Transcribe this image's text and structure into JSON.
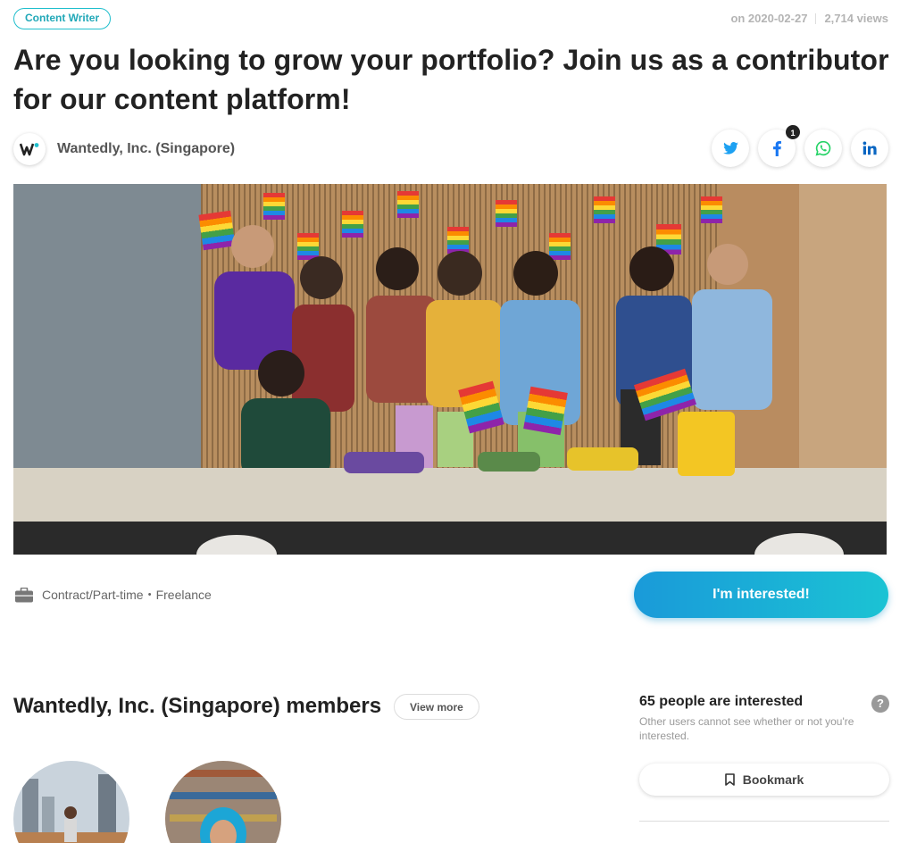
{
  "header": {
    "role_badge": "Content Writer",
    "posted_date": "on 2020-02-27",
    "views": "2,714 views",
    "title": "Are you looking to grow your portfolio? Join us as a contributor for our content platform!"
  },
  "company": {
    "name": "Wantedly, Inc. (Singapore)",
    "logo_icon": "wantedly-logo"
  },
  "share": {
    "buttons": [
      "twitter-icon",
      "facebook-icon",
      "whatsapp-icon",
      "linkedin-icon"
    ],
    "facebook_count": "1"
  },
  "job": {
    "employment_type": "Contract/Part-time・Freelance",
    "cta_label": "I'm interested!"
  },
  "members": {
    "title": "Wantedly, Inc. (Singapore) members",
    "view_more_label": "View more"
  },
  "interest": {
    "count_text": "65 people are interested",
    "note": "Other users cannot see whether or not you're interested.",
    "help_label": "?",
    "bookmark_label": "Bookmark"
  },
  "colors": {
    "accent": "#21bfcd",
    "cta_gradient_start": "#1a9ad9",
    "cta_gradient_end": "#1bc3d4",
    "twitter": "#1da1f2",
    "facebook": "#1877f2",
    "whatsapp": "#25d366",
    "linkedin": "#0a66c2"
  }
}
